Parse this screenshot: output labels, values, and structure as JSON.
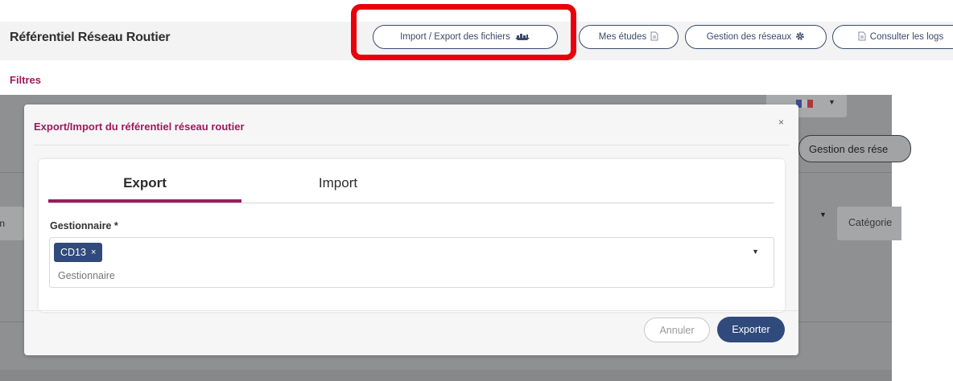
{
  "header": {
    "app_title": "Référentiel Réseau Routier",
    "buttons": {
      "import_export": "Import / Export des fichiers",
      "mes_etudes": "Mes études",
      "gestion_reseaux": "Gestion des réseaux",
      "consulter_logs": "Consulter les logs"
    },
    "icons": {
      "import_export": "ship-icon",
      "mes_etudes": "document-icon",
      "gestion_reseaux": "gear-icon",
      "consulter_logs": "document-icon"
    },
    "highlight_color": "#e8000b"
  },
  "filters": {
    "label": "Filtres"
  },
  "background": {
    "gestion_button": "Gestion des rése",
    "select_partial": "hen",
    "categorie": "Catégorie"
  },
  "modal": {
    "title": "Export/Import du référentiel réseau routier",
    "close": "×",
    "tabs": [
      {
        "label": "Export",
        "active": true
      },
      {
        "label": "Import",
        "active": false
      }
    ],
    "field": {
      "label": "Gestionnaire *",
      "selected": [
        {
          "label": "CD13",
          "remove": "×"
        }
      ],
      "placeholder": "Gestionnaire"
    },
    "buttons": {
      "cancel": "Annuler",
      "submit": "Exporter"
    }
  },
  "colors": {
    "accent": "#9b1b5b",
    "primary": "#2f4a7b"
  }
}
